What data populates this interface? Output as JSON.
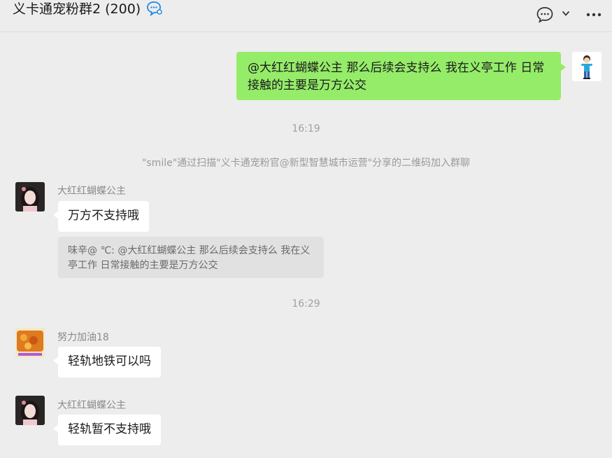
{
  "header": {
    "title": "义卡通宠粉群2 (200)",
    "title_icon": "chat-bubble-refresh-icon",
    "icons": [
      "chat-bubble-icon",
      "chevron-down-icon",
      "more-icon"
    ]
  },
  "messages": {
    "self_1": {
      "text": "@大红红蝴蝶公主  那么后续会支持么  我在义亭工作  日常接触的主要是万方公交"
    },
    "time_1": "16:19",
    "system_1": "\"smile\"通过扫描\"义卡通宠粉官@新型智慧城市运营\"分享的二维码加入群聊",
    "msg_2": {
      "sender": "大红红蝴蝶公主",
      "text": "万方不支持哦",
      "quote": "味辛@  ℃: @大红红蝴蝶公主  那么后续会支持么  我在义亭工作  日常接触的主要是万方公交"
    },
    "time_2": "16:29",
    "msg_3": {
      "sender": "努力加油18",
      "text": "轻轨地铁可以吗"
    },
    "msg_4": {
      "sender": "大红红蝴蝶公主",
      "text": "轻轨暂不支持哦"
    }
  },
  "colors": {
    "background": "#ededed",
    "self_bubble": "#95ec69",
    "other_bubble": "#ffffff",
    "quote_bg": "#e1e1e1",
    "title_icon": "#1e88e5"
  }
}
